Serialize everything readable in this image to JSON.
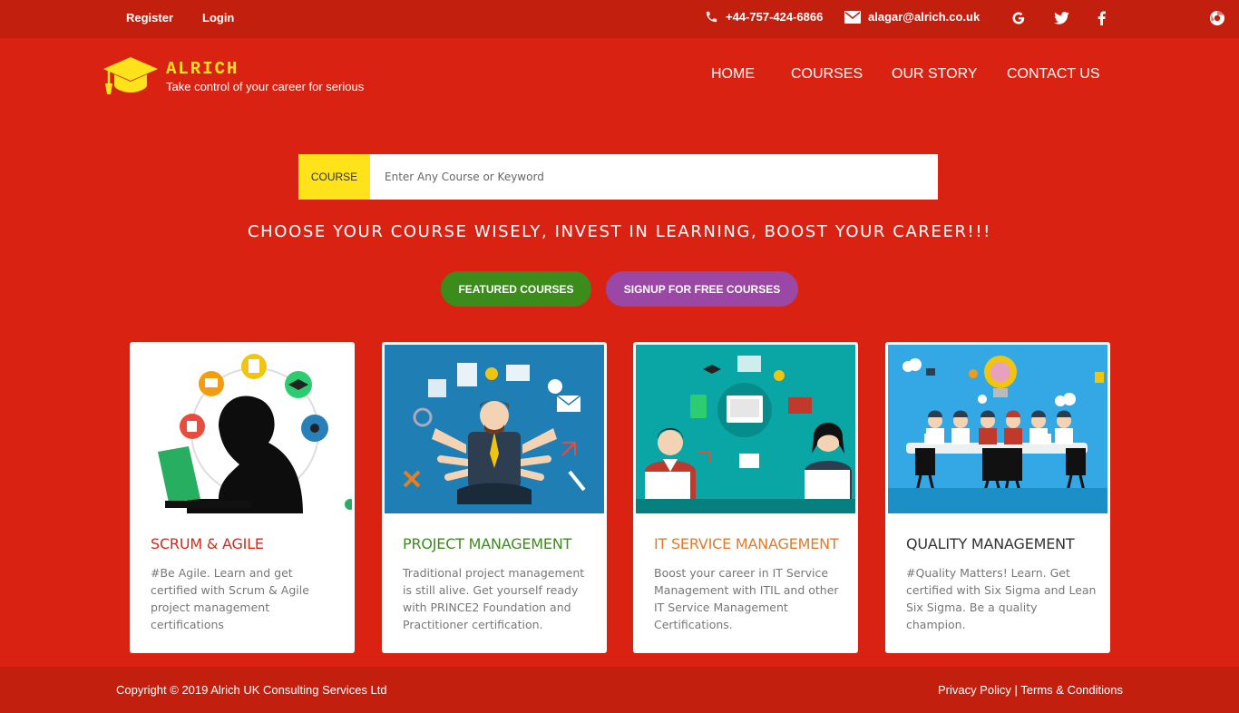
{
  "topbar": {
    "register": "Register",
    "login": "Login",
    "phone": "+44-757-424-6866",
    "email": "alagar@alrich.co.uk",
    "social": [
      "google-icon",
      "twitter-icon",
      "facebook-icon"
    ],
    "corner_icon": "chrome-extension-icon"
  },
  "header": {
    "brand": "ALRICH",
    "tagline": "Take control of your career for serious",
    "nav": [
      "HOME",
      "COURSES",
      "OUR STORY",
      "CONTACT US"
    ]
  },
  "search": {
    "label": "COURSE",
    "placeholder": "Enter Any Course or Keyword"
  },
  "headline": "CHOOSE YOUR COURSE WISELY, INVEST IN LEARNING, BOOST YOUR CAREER!!!",
  "buttons": {
    "featured": "FEATURED COURSES",
    "signup": "SIGNUP FOR FREE COURSES"
  },
  "cards": [
    {
      "title": "SCRUM & AGILE",
      "color": "#d32a1c",
      "text": "#Be Agile. Learn and get certified with Scrum & Agile project management certifications"
    },
    {
      "title": "PROJECT MANAGEMENT",
      "color": "#3c8c1c",
      "text": "Traditional project management is still alive. Get yourself ready with PRINCE2 Foundation and Practitioner certification."
    },
    {
      "title": "IT SERVICE MANAGEMENT",
      "color": "#e07a2c",
      "text": "Boost your career in IT Service Management with ITIL and other IT Service Management Certifications."
    },
    {
      "title": "QUALITY MANAGEMENT",
      "color": "#333333",
      "text": "#Quality Matters! Learn. Get certified with Six Sigma and Lean Six Sigma. Be a quality champion."
    }
  ],
  "footer": {
    "copyright": "Copyright © 2019 Alrich UK Consulting Services Ltd",
    "privacy": "Privacy Policy",
    "separator": "|",
    "terms": "Terms & Conditions"
  },
  "colors": {
    "background": "#d92212",
    "bar": "#c21f0f",
    "accent": "#ffe31a",
    "featured": "#3c8c1c",
    "signup": "#9a47a6"
  }
}
